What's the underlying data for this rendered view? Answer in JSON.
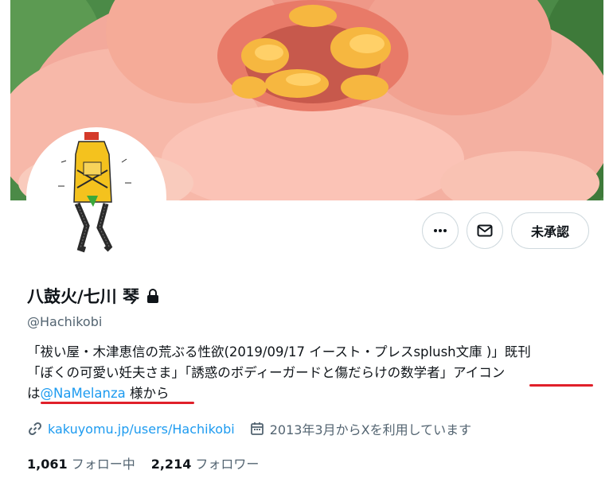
{
  "profile": {
    "display_name": "八鼓火/七川 琴",
    "handle": "@Hachikobi",
    "lock_icon": "lock-icon",
    "bio_line1": "「祓い屋・木津恵信の荒ぶる性欲(2019/09/17 イースト・プレスsplush文庫 )」既刊",
    "bio_line2_pre": "「ぼくの可愛い妊夫さま」「誘惑のボディーガードと傷だらけの数学者」",
    "bio_line2_post": "アイコン",
    "bio_line3_pre": "は",
    "bio_mention": "@NaMelanza",
    "bio_line3_post": " 様から",
    "website": "kakuyomu.jp/users/Hachikobi",
    "joined": "2013年3月からXを利用しています",
    "following_count": "1,061",
    "following_label": "フォロー中",
    "followers_count": "2,214",
    "followers_label": "フォロワー"
  },
  "actions": {
    "more_icon": "more-icon",
    "message_icon": "mail-icon",
    "follow_request_label": "未承認"
  },
  "colors": {
    "link": "#1d9bf0",
    "secondary_text": "#536471",
    "annotation_underline": "#e0202a"
  }
}
